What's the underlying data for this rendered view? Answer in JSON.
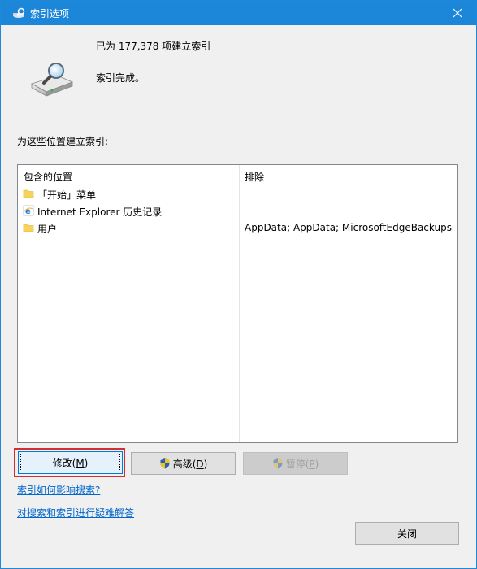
{
  "window": {
    "title": "索引选项"
  },
  "status": {
    "count_text": "已为 177,378 项建立索引",
    "message": "索引完成。"
  },
  "locations": {
    "label": "为这些位置建立索引:",
    "col_included": "包含的位置",
    "col_excluded": "排除",
    "rows": [
      {
        "icon": "folder-icon",
        "location": "「开始」菜单",
        "exclude": ""
      },
      {
        "icon": "internet-explorer-icon",
        "location": "Internet Explorer 历史记录",
        "exclude": ""
      },
      {
        "icon": "folder-icon",
        "location": "用户",
        "exclude": "AppData; AppData; MicrosoftEdgeBackups"
      }
    ]
  },
  "buttons": {
    "modify": {
      "text": "修改(",
      "key": "M",
      "end": ")"
    },
    "advanced": {
      "text": "高级(",
      "key": "D",
      "end": ")"
    },
    "pause": {
      "text": "暂停(",
      "key": "P",
      "end": ")"
    },
    "close": "关闭"
  },
  "links": {
    "affect_search": "索引如何影响搜索?",
    "troubleshoot": "对搜索和索引进行疑难解答"
  },
  "colors": {
    "titlebar": "#1c86d9",
    "focus_highlight": "#d32f2f",
    "link": "#0066cc"
  }
}
